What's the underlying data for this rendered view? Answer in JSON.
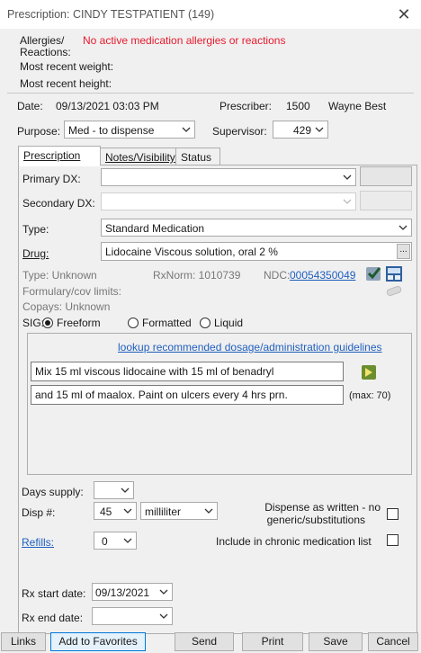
{
  "window": {
    "title": "Prescription: CINDY TESTPATIENT (149)"
  },
  "patient": {
    "allergies_label": "Allergies/",
    "reactions_label": "Reactions:",
    "allergies_value": "No active medication allergies or reactions",
    "weight_label": "Most recent weight:",
    "height_label": "Most recent height:"
  },
  "header": {
    "date_label": "Date:",
    "date_value": "09/13/2021 03:03 PM",
    "prescriber_label": "Prescriber:",
    "prescriber_id": "1500",
    "prescriber_name": "Wayne Best",
    "purpose_label": "Purpose:",
    "purpose_value": "Med - to dispense",
    "supervisor_label": "Supervisor:",
    "supervisor_value": "429"
  },
  "tabs": [
    "Prescription",
    "Notes/Visibility",
    "Status"
  ],
  "rx": {
    "primary_dx_label": "Primary DX:",
    "secondary_dx_label": "Secondary DX:",
    "type_label": "Type:",
    "type_value": "Standard Medication",
    "drug_label": "Drug:",
    "drug_value": "Lidocaine Viscous solution, oral 2 %",
    "browse_label": "...",
    "info_type": "Type:  Unknown",
    "info_rxnorm": "RxNorm:  1010739",
    "info_ndc_label": "NDC:",
    "info_ndc_value": "00054350049",
    "formulary_label": "Formulary/cov limits:",
    "copays_label": "Copays:  Unknown",
    "sig_label": "SIG:",
    "sig_options": [
      "Freeform",
      "Formatted",
      "Liquid"
    ],
    "lookup_link": "lookup recommended dosage/administration guidelines",
    "sig_line1": "Mix 15 ml viscous lidocaine with 15 ml of benadryl",
    "sig_line2": "and 15 ml of maalox. Paint on ulcers every 4 hrs prn.",
    "max_note": "(max: 70)",
    "days_supply_label": "Days supply:",
    "disp_label": "Disp #:",
    "disp_qty": "45",
    "disp_unit": "milliliter",
    "daw_label_1": "Dispense as written - no",
    "daw_label_2": "generic/substitutions",
    "refills_label": "Refills:",
    "refills_value": "0",
    "chronic_label": "Include in chronic medication list",
    "start_label": "Rx start date:",
    "start_value": "09/13/2021",
    "end_label": "Rx end date:",
    "end_value": ""
  },
  "footer": {
    "links": "Links",
    "favorites": "Add to Favorites",
    "send": "Send",
    "print": "Print",
    "save": "Save",
    "cancel": "Cancel"
  }
}
